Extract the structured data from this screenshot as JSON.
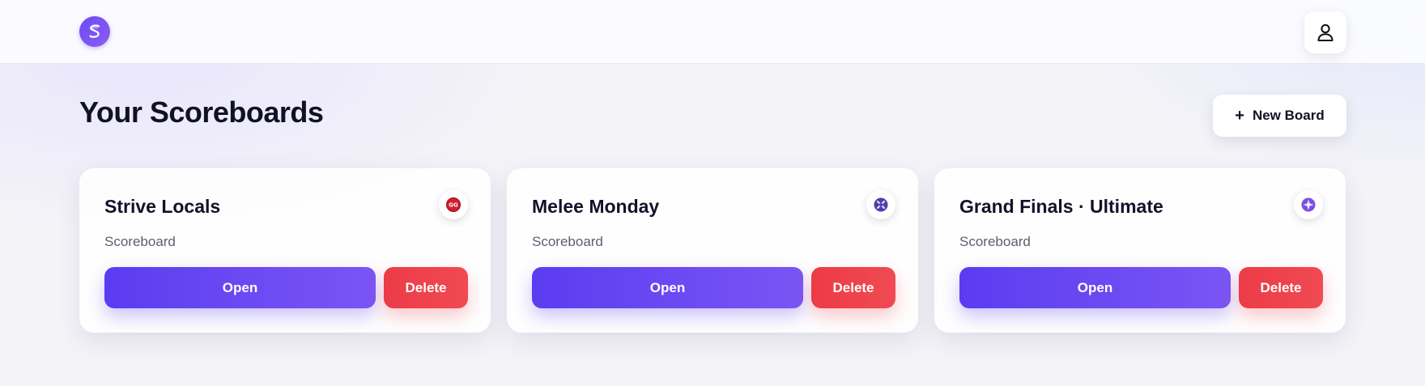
{
  "header": {
    "logo_icon": "s-logo-icon",
    "profile_icon": "user-icon"
  },
  "main": {
    "title": "Your Scoreboards",
    "new_board_label": "New Board",
    "new_board_icon": "plus-icon"
  },
  "colors": {
    "primary": "#5b3cf0",
    "danger": "#ec3b48",
    "text": "#0f1225"
  },
  "cards": [
    {
      "title": "Strive Locals",
      "subtitle": "Scoreboard",
      "badge_icon": "guilty-gear-icon",
      "open_label": "Open",
      "delete_label": "Delete"
    },
    {
      "title": "Melee Monday",
      "subtitle": "Scoreboard",
      "badge_icon": "smash-melee-icon",
      "open_label": "Open",
      "delete_label": "Delete"
    },
    {
      "title": "Grand Finals · Ultimate",
      "subtitle": "Scoreboard",
      "badge_icon": "smash-ultimate-icon",
      "open_label": "Open",
      "delete_label": "Delete"
    }
  ]
}
